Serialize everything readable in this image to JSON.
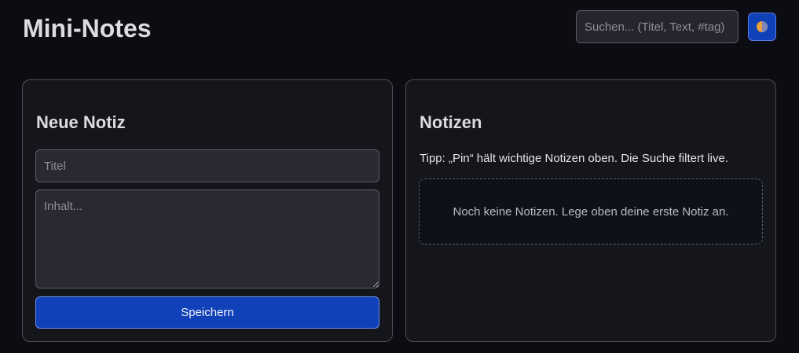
{
  "header": {
    "title": "Mini-Notes",
    "search_placeholder": "Suchen... (Titel, Text, #tag)",
    "theme_icon": "half-moon-icon"
  },
  "new_note": {
    "heading": "Neue Notiz",
    "title_placeholder": "Titel",
    "content_placeholder": "Inhalt...",
    "save_label": "Speichern"
  },
  "notes": {
    "heading": "Notizen",
    "tip": "Tipp: „Pin“ hält wichtige Notizen oben. Die Suche filtert live.",
    "empty_message": "Noch keine Notizen. Lege oben deine erste Notiz an."
  },
  "colors": {
    "background": "#0c0d12",
    "card": "#14161b",
    "accent": "#1141b8",
    "input": "#2a2932"
  }
}
